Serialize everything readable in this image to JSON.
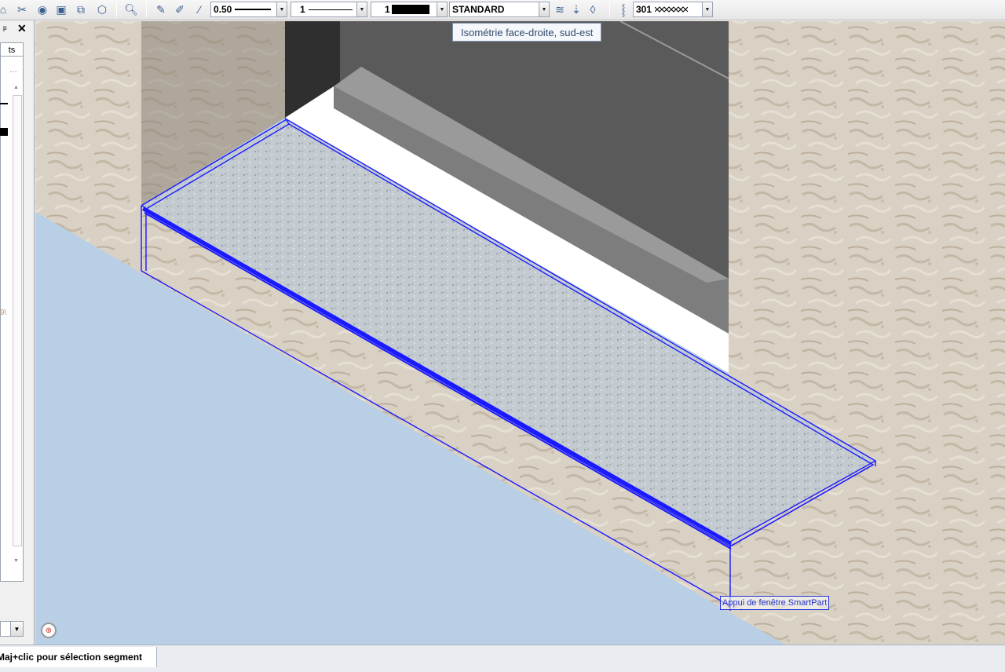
{
  "toolbar": {
    "icons": [
      "layer-icon",
      "tools-icon",
      "eye-icon",
      "open-folder-icon",
      "copy-view-icon",
      "cube-icon",
      "zoom-query-icon",
      "paint-brush-icon",
      "pen-icon",
      "pipette-icon"
    ],
    "pen_thickness": "0.50",
    "line_type": "1",
    "color_number": "1",
    "layer_name": "STANDARD",
    "layer_icons": [
      "layer-stack-icon",
      "layer-down-icon",
      "layer-eraser-icon"
    ],
    "hatch_number": "301"
  },
  "tooltip": {
    "text": "Isométrie face-droite, sud-est"
  },
  "left_panel": {
    "pin": "ᵖ",
    "close": "✕",
    "tab_label": "ts",
    "more": "…",
    "partial_tag": "9\\"
  },
  "viewport": {
    "object_label": "Appui de fenêtre SmartPart",
    "colors": {
      "background": "#b9cfe6",
      "wall_render": "#d8d0c4",
      "window_frame": "#555555",
      "selection": "#1a1aff",
      "sill_stone": "#c4ccd2"
    }
  },
  "statusbar": {
    "hint": "Maj+clic pour sélection segment"
  }
}
